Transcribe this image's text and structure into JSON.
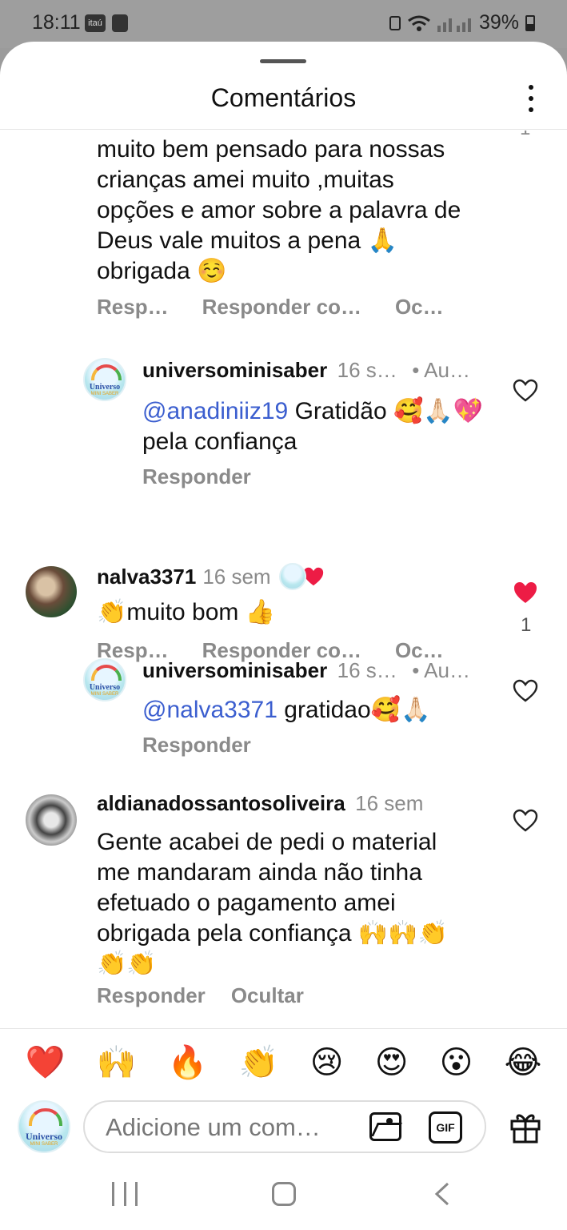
{
  "status_bar": {
    "time": "18:11",
    "carrier_badge": "itaú",
    "battery": "39%"
  },
  "sheet": {
    "title": "Comentários"
  },
  "comments": [
    {
      "id": "c1-tail",
      "text": "muito bem pensado para nossas crianças amei muito ,muitas opções e amor sobre a palavra de Deus vale muitos a pena 🙏 obrigada ☺️",
      "like_count": "1",
      "actions": [
        "Resp…",
        "Responder co…",
        "Oc…"
      ]
    },
    {
      "id": "r1",
      "username": "universominisaber",
      "meta": "16 s…",
      "meta2": "• Au…",
      "mention": "@anadiniiz19",
      "text": " Gratidão 🥰🙏🏻💖pela confiança",
      "actions": [
        "Responder"
      ]
    },
    {
      "id": "c2",
      "username": "nalva3371",
      "meta": "16 sem",
      "text": "👏muito  bom 👍",
      "like_count": "1",
      "actions": [
        "Resp…",
        "Responder co…",
        "Oc…"
      ]
    },
    {
      "id": "r2",
      "username": "universominisaber",
      "meta": "16 s…",
      "meta2": "• Au…",
      "mention": "@nalva3371",
      "text": " gratidao🥰🙏🏻",
      "actions": [
        "Responder"
      ]
    },
    {
      "id": "c3",
      "username": "aldianadossantosoliveira",
      "meta": "16 sem",
      "text": "Gente acabei de pedi o material me mandaram  ainda não tinha efetuado o pagamento  amei obrigada pela confiança 🙌🙌👏👏👏",
      "actions": [
        "Responder",
        "Ocultar"
      ]
    }
  ],
  "avatar_brand": {
    "label": "Universo",
    "sublabel": "MINI SABER"
  },
  "reactions": [
    "❤️",
    "🙌",
    "🔥",
    "👏",
    "😢",
    "😍",
    "😮",
    "😂"
  ],
  "composer": {
    "placeholder": "Adicione um com…",
    "gif_label": "GIF"
  },
  "colors": {
    "mention": "#3b5ecf",
    "liked_heart": "#ed1c45",
    "muted": "#8a8a8a"
  },
  "icons": [
    "wifi-icon",
    "signal-icon",
    "battery-icon",
    "more-vertical-icon",
    "heart-icon",
    "image-icon",
    "gif-icon",
    "gift-icon",
    "recent-apps-icon",
    "home-icon",
    "back-icon"
  ]
}
